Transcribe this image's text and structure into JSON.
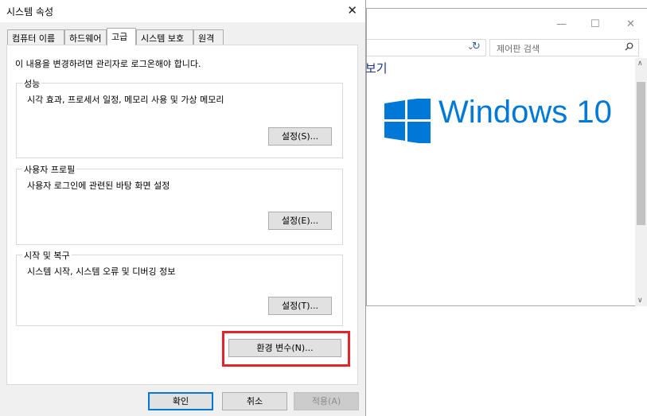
{
  "background_window": {
    "title_fragment": "보기",
    "search_placeholder": "제어판 검색",
    "logo_text": "Windows 10",
    "controls": {
      "minimize": "—",
      "maximize": "☐",
      "close": "✕"
    }
  },
  "dialog": {
    "title": "시스템 속성",
    "close": "✕",
    "tabs": [
      "컴퓨터 이름",
      "하드웨어",
      "고급",
      "시스템 보호",
      "원격"
    ],
    "active_tab": "고급",
    "note": "이 내용을 변경하려면 관리자로 로그온해야 합니다.",
    "performance": {
      "legend": "성능",
      "desc": "시각 효과, 프로세서 일정, 메모리 사용 및 가상 메모리",
      "button": "설정(S)..."
    },
    "user_profiles": {
      "legend": "사용자 프로필",
      "desc": "사용자 로그인에 관련된 바탕 화면 설정",
      "button": "설정(E)..."
    },
    "startup_recovery": {
      "legend": "시작 및 복구",
      "desc": "시스템 시작, 시스템 오류 및 디버깅 정보",
      "button": "설정(T)..."
    },
    "env_button": "환경 변수(N)...",
    "footer": {
      "ok": "확인",
      "cancel": "취소",
      "apply": "적용(A)"
    }
  },
  "colors": {
    "accent": "#0078d7",
    "highlight": "#e3242b"
  }
}
